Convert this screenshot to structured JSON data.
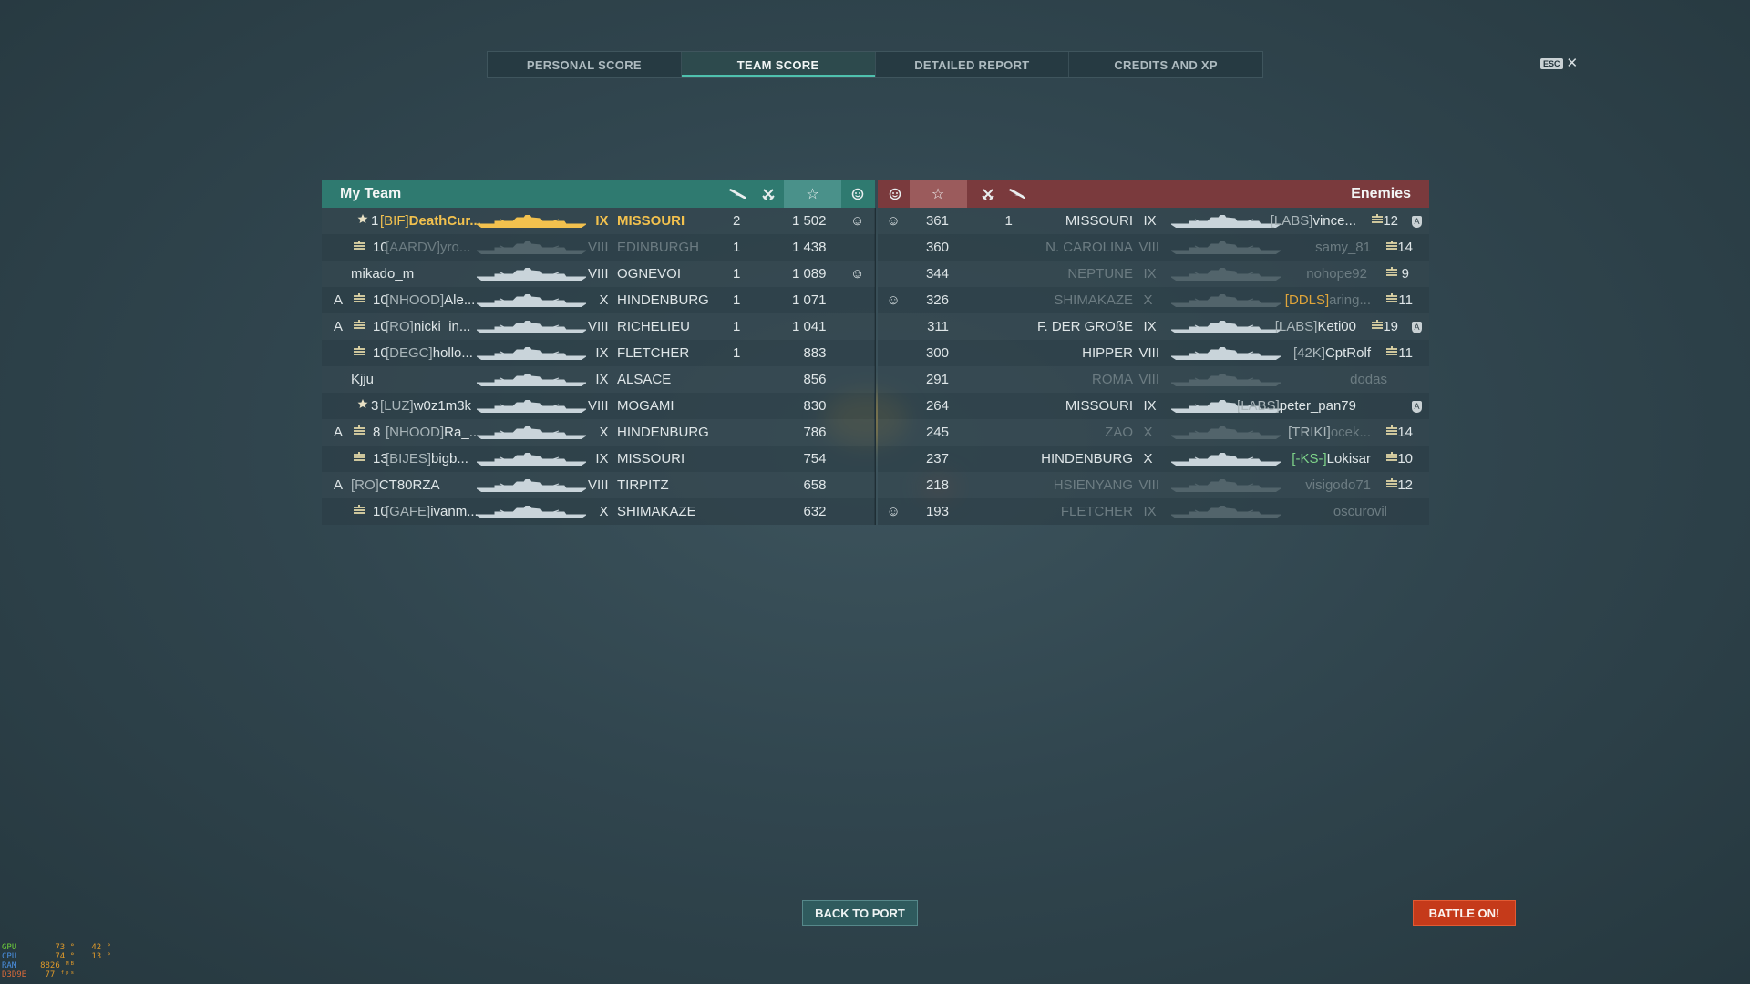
{
  "tabs": [
    {
      "label": "PERSONAL SCORE",
      "active": false
    },
    {
      "label": "TEAM SCORE",
      "active": true
    },
    {
      "label": "DETAILED REPORT",
      "active": false
    },
    {
      "label": "CREDITS AND XP",
      "active": false
    }
  ],
  "esc": {
    "key": "ESC",
    "close": "✕"
  },
  "my_team": {
    "title": "My Team",
    "color": "#2f7a70"
  },
  "enemies": {
    "title": "Enemies",
    "color": "#7a3a3d"
  },
  "header_icons": {
    "planes": "plane-icon",
    "kills": "crossed-swords-icon",
    "score": "☆",
    "bot": "smiley-icon"
  },
  "my_rows": [
    {
      "rank": "1",
      "clan": "[BIF]",
      "name": "DeathCur...",
      "tier": "IX",
      "ship": "MISSOURI",
      "kills": "2",
      "score": "1 502",
      "smile": "☺",
      "highlight": true,
      "badge": "",
      "rank_icon": "star"
    },
    {
      "rank": "10",
      "clan": "[AARDV]",
      "name": "yro...",
      "tier": "VIII",
      "ship": "EDINBURGH",
      "kills": "1",
      "score": "1 438",
      "smile": "",
      "dim": true,
      "badge": ""
    },
    {
      "rank": "",
      "clan": "",
      "name": "mikado_m",
      "tier": "VIII",
      "ship": "OGNEVOI",
      "kills": "1",
      "score": "1 089",
      "smile": "☺",
      "badge": ""
    },
    {
      "rank": "10",
      "clan": "[NHOOD]",
      "name": "Ale...",
      "tier": "X",
      "ship": "HINDENBURG",
      "kills": "1",
      "score": "1 071",
      "smile": "",
      "badge": "A"
    },
    {
      "rank": "10",
      "clan": "[RO]",
      "name": "nicki_in...",
      "tier": "VIII",
      "ship": "RICHELIEU",
      "kills": "1",
      "score": "1 041",
      "smile": "",
      "badge": "A"
    },
    {
      "rank": "10",
      "clan": "[DEGC]",
      "name": "hollo...",
      "tier": "IX",
      "ship": "FLETCHER",
      "kills": "1",
      "score": "883",
      "smile": "",
      "badge": ""
    },
    {
      "rank": "",
      "clan": "",
      "name": "Kjju",
      "tier": "IX",
      "ship": "ALSACE",
      "kills": "",
      "score": "856",
      "smile": "",
      "badge": ""
    },
    {
      "rank": "3",
      "clan": "[LUZ]",
      "name": "w0z1m3k",
      "tier": "VIII",
      "ship": "MOGAMI",
      "kills": "",
      "score": "830",
      "smile": "",
      "badge": "",
      "rank_icon": "star1"
    },
    {
      "rank": "8",
      "clan": "[NHOOD]",
      "name": "Ra_...",
      "tier": "X",
      "ship": "HINDENBURG",
      "kills": "",
      "score": "786",
      "smile": "",
      "badge": "A"
    },
    {
      "rank": "13",
      "clan": "[BIJES]",
      "name": "bigb...",
      "tier": "IX",
      "ship": "MISSOURI",
      "kills": "",
      "score": "754",
      "smile": "",
      "badge": ""
    },
    {
      "rank": "",
      "clan": "[RO]",
      "name": "CT80RZA",
      "tier": "VIII",
      "ship": "TIRPITZ",
      "kills": "",
      "score": "658",
      "smile": "",
      "badge": "A",
      "noicon": true
    },
    {
      "rank": "10",
      "clan": "[GAFE]",
      "name": "ivanm...",
      "tier": "X",
      "ship": "SHIMAKAZE",
      "kills": "",
      "score": "632",
      "smile": "",
      "badge": ""
    }
  ],
  "enemy_rows": [
    {
      "smile": "☺",
      "score": "361",
      "kills": "1",
      "ship": "MISSOURI",
      "tier": "IX",
      "clan": "[LABS]",
      "name": "vince...",
      "rank": "12",
      "badge": "A",
      "dim": false
    },
    {
      "smile": "",
      "score": "360",
      "kills": "",
      "ship": "N. CAROLINA",
      "tier": "VIII",
      "clan": "",
      "name": "samy_81",
      "rank": "14",
      "badge": "",
      "dim": true
    },
    {
      "smile": "",
      "score": "344",
      "kills": "",
      "ship": "NEPTUNE",
      "tier": "IX",
      "clan": "",
      "name": "nohope92",
      "rank": "9",
      "badge": "",
      "dim": true
    },
    {
      "smile": "☺",
      "score": "326",
      "kills": "",
      "ship": "SHIMAKAZE",
      "tier": "X",
      "clan": "[DDLS]",
      "name": "aring...",
      "rank": "11",
      "badge": "",
      "dim": true,
      "clan_color": "orange"
    },
    {
      "smile": "",
      "score": "311",
      "kills": "",
      "ship": "F. DER GROßE",
      "tier": "IX",
      "clan": "[LABS]",
      "name": "Keti00",
      "rank": "19",
      "badge": "A",
      "dim": false
    },
    {
      "smile": "",
      "score": "300",
      "kills": "",
      "ship": "HIPPER",
      "tier": "VIII",
      "clan": "[42K]",
      "name": "CptRolf",
      "rank": "11",
      "badge": "",
      "dim": false
    },
    {
      "smile": "",
      "score": "291",
      "kills": "",
      "ship": "ROMA",
      "tier": "VIII",
      "clan": "",
      "name": "dodas",
      "rank": "",
      "badge": "",
      "dim": true
    },
    {
      "smile": "",
      "score": "264",
      "kills": "",
      "ship": "MISSOURI",
      "tier": "IX",
      "clan": "[LABS]",
      "name": "peter_pan79",
      "rank": "",
      "badge": "A",
      "dim": false
    },
    {
      "smile": "",
      "score": "245",
      "kills": "",
      "ship": "ZAO",
      "tier": "X",
      "clan": "[TRIKI]",
      "name": "ocek...",
      "rank": "14",
      "badge": "",
      "dim": true,
      "clan_bright": true
    },
    {
      "smile": "",
      "score": "237",
      "kills": "",
      "ship": "HINDENBURG",
      "tier": "X",
      "clan": "[-KS-]",
      "name": "Lokisar",
      "rank": "10",
      "badge": "",
      "dim": false,
      "clan_color": "green"
    },
    {
      "smile": "",
      "score": "218",
      "kills": "",
      "ship": "HSIENYANG",
      "tier": "VIII",
      "clan": "",
      "name": "visigodo71",
      "rank": "12",
      "badge": "",
      "dim": true
    },
    {
      "smile": "☺",
      "score": "193",
      "kills": "",
      "ship": "FLETCHER",
      "tier": "IX",
      "clan": "",
      "name": "oscurovil",
      "rank": "",
      "badge": "",
      "dim": true
    }
  ],
  "buttons": {
    "back": "BACK TO PORT",
    "battle": "BATTLE ON!"
  },
  "osd": [
    {
      "label": "GPU",
      "v1": "73 °",
      "v2": "42 °"
    },
    {
      "label": "CPU",
      "v1": "74 °",
      "v2": "13 °"
    },
    {
      "label": "RAM",
      "v1": "8826 ᴹᴮ",
      "v2": ""
    },
    {
      "label": "D3D9E",
      "v1": "77 ᶠᵖˢ",
      "v2": ""
    }
  ]
}
